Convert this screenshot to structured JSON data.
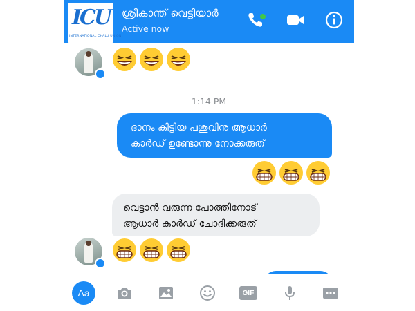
{
  "header": {
    "logo_text": "ICU",
    "logo_caption": "INTERNATIONAL CHALU UNION",
    "contact_name": "ശ്രീകാന്ത് വെട്ടിയാർ",
    "contact_status": "Active now",
    "icons": [
      "phone-icon",
      "video-camera-icon",
      "info-icon"
    ]
  },
  "chat": {
    "timestamp": "1:14 PM",
    "messages": [
      {
        "from": "contact",
        "type": "emoji",
        "emoji": [
          "grinning-squint",
          "grinning-squint",
          "grinning-squint"
        ]
      },
      {
        "from": "me",
        "type": "text",
        "lines": [
          "ദാനം കിട്ടിയ പശുവിനു ആധാർ",
          "കാർഡ് ഉണ്ടോന്നു നോക്കരുത്"
        ]
      },
      {
        "from": "me",
        "type": "emoji",
        "emoji": [
          "grimacing-grin",
          "grimacing-grin",
          "grimacing-grin"
        ]
      },
      {
        "from": "contact",
        "type": "text",
        "lines": [
          "വെട്ടാൻ വരുന്ന പോത്തിനോട്",
          "ആധാർ കാർഡ് ചോദിക്കരുത്"
        ]
      },
      {
        "from": "contact",
        "type": "emoji",
        "emoji": [
          "grimacing-grin",
          "grimacing-grin",
          "grimacing-grin"
        ]
      }
    ]
  },
  "composer": {
    "aa_label": "Aa",
    "gif_label": "GIF",
    "tools": [
      "camera-icon",
      "photo-icon",
      "emoji-icon",
      "microphone-icon",
      "more-icon"
    ]
  },
  "colors": {
    "accent": "#1a8af5",
    "incoming_bubble": "#eceef0",
    "online": "#42c748",
    "emoji_yellow": "#ffcc33"
  }
}
